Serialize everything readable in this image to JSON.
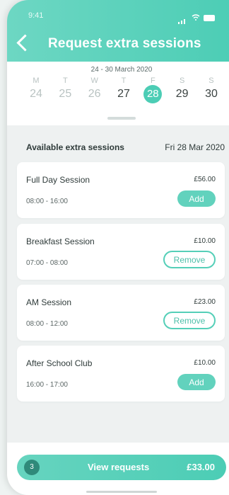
{
  "status_bar": {
    "time": "9:41"
  },
  "header": {
    "title": "Request extra sessions"
  },
  "calendar": {
    "week_range": "24 - 30 March 2020",
    "day_letters": [
      "M",
      "T",
      "W",
      "T",
      "F",
      "S",
      "S"
    ],
    "day_numbers": [
      "24",
      "25",
      "26",
      "27",
      "28",
      "29",
      "30"
    ],
    "selected_day": "28"
  },
  "section": {
    "title": "Available extra sessions",
    "date": "Fri 28 Mar 2020"
  },
  "sessions": [
    {
      "name": "Full Day Session",
      "price": "£56.00",
      "time": "08:00 - 16:00",
      "action": "Add"
    },
    {
      "name": "Breakfast Session",
      "price": "£10.00",
      "time": "07:00 - 08:00",
      "action": "Remove"
    },
    {
      "name": "AM Session",
      "price": "£23.00",
      "time": "08:00 - 12:00",
      "action": "Remove"
    },
    {
      "name": "After School Club",
      "price": "£10.00",
      "time": "16:00 - 17:00",
      "action": "Add"
    }
  ],
  "footer": {
    "count": "3",
    "label": "View requests",
    "total": "£33.00"
  },
  "colors": {
    "accent": "#4ccdb5",
    "accent_dark": "#2f8a7a"
  }
}
